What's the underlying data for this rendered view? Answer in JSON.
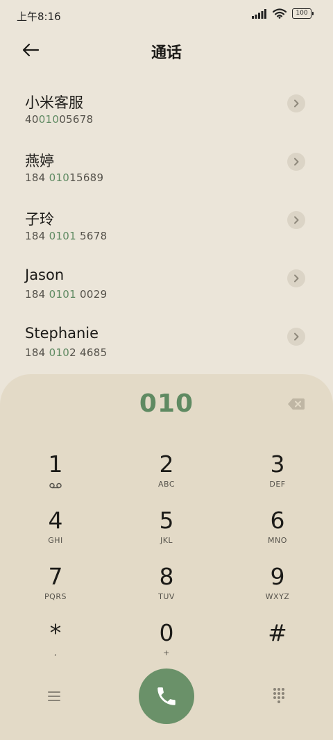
{
  "status_bar": {
    "time": "上午8:16",
    "battery": "100"
  },
  "header": {
    "title": "通话"
  },
  "contacts": [
    {
      "name": "小米客服",
      "number_pre": "40",
      "number_match": "010",
      "number_post": "05678"
    },
    {
      "name": "燕婷",
      "number_pre": "184 ",
      "number_match": "010",
      "number_post": "15689"
    },
    {
      "name": "子玲",
      "number_pre": "184 ",
      "number_match": "0101",
      "number_post": " 5678"
    },
    {
      "name": "Jason",
      "number_pre": "184 ",
      "number_match": "0101",
      "number_post": " 0029"
    },
    {
      "name": "Stephanie",
      "number_pre": "184 ",
      "number_match": "010",
      "number_post": "2 4685"
    }
  ],
  "dialer": {
    "input": "010",
    "keys": [
      {
        "digit": "1",
        "letters": ""
      },
      {
        "digit": "2",
        "letters": "ABC"
      },
      {
        "digit": "3",
        "letters": "DEF"
      },
      {
        "digit": "4",
        "letters": "GHI"
      },
      {
        "digit": "5",
        "letters": "JKL"
      },
      {
        "digit": "6",
        "letters": "MNO"
      },
      {
        "digit": "7",
        "letters": "PQRS"
      },
      {
        "digit": "8",
        "letters": "TUV"
      },
      {
        "digit": "9",
        "letters": "WXYZ"
      },
      {
        "digit": "*",
        "letters": ","
      },
      {
        "digit": "0",
        "letters": "+"
      },
      {
        "digit": "#",
        "letters": ""
      }
    ]
  },
  "icons": {
    "back": "arrow-left-icon",
    "detail": "chevron-right-icon",
    "backspace": "backspace-icon",
    "voicemail": "voicemail-icon",
    "menu": "menu-icon",
    "call": "phone-icon",
    "dialpad": "dialpad-icon"
  },
  "colors": {
    "background": "#ebe5d9",
    "dialer_panel": "#e3dac7",
    "accent_green": "#5f8a62",
    "call_button": "#6a9169"
  }
}
